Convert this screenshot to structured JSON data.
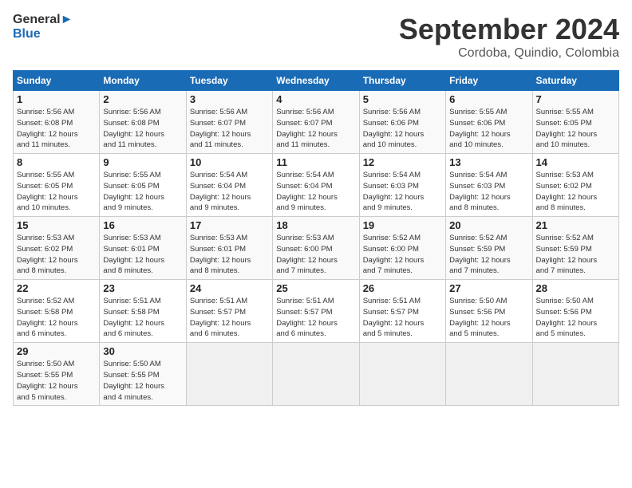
{
  "logo": {
    "line1": "General",
    "line2": "Blue"
  },
  "title": "September 2024",
  "subtitle": "Cordoba, Quindio, Colombia",
  "days_header": [
    "Sunday",
    "Monday",
    "Tuesday",
    "Wednesday",
    "Thursday",
    "Friday",
    "Saturday"
  ],
  "weeks": [
    [
      {
        "day": "1",
        "info": "Sunrise: 5:56 AM\nSunset: 6:08 PM\nDaylight: 12 hours\nand 11 minutes."
      },
      {
        "day": "2",
        "info": "Sunrise: 5:56 AM\nSunset: 6:08 PM\nDaylight: 12 hours\nand 11 minutes."
      },
      {
        "day": "3",
        "info": "Sunrise: 5:56 AM\nSunset: 6:07 PM\nDaylight: 12 hours\nand 11 minutes."
      },
      {
        "day": "4",
        "info": "Sunrise: 5:56 AM\nSunset: 6:07 PM\nDaylight: 12 hours\nand 11 minutes."
      },
      {
        "day": "5",
        "info": "Sunrise: 5:56 AM\nSunset: 6:06 PM\nDaylight: 12 hours\nand 10 minutes."
      },
      {
        "day": "6",
        "info": "Sunrise: 5:55 AM\nSunset: 6:06 PM\nDaylight: 12 hours\nand 10 minutes."
      },
      {
        "day": "7",
        "info": "Sunrise: 5:55 AM\nSunset: 6:05 PM\nDaylight: 12 hours\nand 10 minutes."
      }
    ],
    [
      {
        "day": "8",
        "info": "Sunrise: 5:55 AM\nSunset: 6:05 PM\nDaylight: 12 hours\nand 10 minutes."
      },
      {
        "day": "9",
        "info": "Sunrise: 5:55 AM\nSunset: 6:05 PM\nDaylight: 12 hours\nand 9 minutes."
      },
      {
        "day": "10",
        "info": "Sunrise: 5:54 AM\nSunset: 6:04 PM\nDaylight: 12 hours\nand 9 minutes."
      },
      {
        "day": "11",
        "info": "Sunrise: 5:54 AM\nSunset: 6:04 PM\nDaylight: 12 hours\nand 9 minutes."
      },
      {
        "day": "12",
        "info": "Sunrise: 5:54 AM\nSunset: 6:03 PM\nDaylight: 12 hours\nand 9 minutes."
      },
      {
        "day": "13",
        "info": "Sunrise: 5:54 AM\nSunset: 6:03 PM\nDaylight: 12 hours\nand 8 minutes."
      },
      {
        "day": "14",
        "info": "Sunrise: 5:53 AM\nSunset: 6:02 PM\nDaylight: 12 hours\nand 8 minutes."
      }
    ],
    [
      {
        "day": "15",
        "info": "Sunrise: 5:53 AM\nSunset: 6:02 PM\nDaylight: 12 hours\nand 8 minutes."
      },
      {
        "day": "16",
        "info": "Sunrise: 5:53 AM\nSunset: 6:01 PM\nDaylight: 12 hours\nand 8 minutes."
      },
      {
        "day": "17",
        "info": "Sunrise: 5:53 AM\nSunset: 6:01 PM\nDaylight: 12 hours\nand 8 minutes."
      },
      {
        "day": "18",
        "info": "Sunrise: 5:53 AM\nSunset: 6:00 PM\nDaylight: 12 hours\nand 7 minutes."
      },
      {
        "day": "19",
        "info": "Sunrise: 5:52 AM\nSunset: 6:00 PM\nDaylight: 12 hours\nand 7 minutes."
      },
      {
        "day": "20",
        "info": "Sunrise: 5:52 AM\nSunset: 5:59 PM\nDaylight: 12 hours\nand 7 minutes."
      },
      {
        "day": "21",
        "info": "Sunrise: 5:52 AM\nSunset: 5:59 PM\nDaylight: 12 hours\nand 7 minutes."
      }
    ],
    [
      {
        "day": "22",
        "info": "Sunrise: 5:52 AM\nSunset: 5:58 PM\nDaylight: 12 hours\nand 6 minutes."
      },
      {
        "day": "23",
        "info": "Sunrise: 5:51 AM\nSunset: 5:58 PM\nDaylight: 12 hours\nand 6 minutes."
      },
      {
        "day": "24",
        "info": "Sunrise: 5:51 AM\nSunset: 5:57 PM\nDaylight: 12 hours\nand 6 minutes."
      },
      {
        "day": "25",
        "info": "Sunrise: 5:51 AM\nSunset: 5:57 PM\nDaylight: 12 hours\nand 6 minutes."
      },
      {
        "day": "26",
        "info": "Sunrise: 5:51 AM\nSunset: 5:57 PM\nDaylight: 12 hours\nand 5 minutes."
      },
      {
        "day": "27",
        "info": "Sunrise: 5:50 AM\nSunset: 5:56 PM\nDaylight: 12 hours\nand 5 minutes."
      },
      {
        "day": "28",
        "info": "Sunrise: 5:50 AM\nSunset: 5:56 PM\nDaylight: 12 hours\nand 5 minutes."
      }
    ],
    [
      {
        "day": "29",
        "info": "Sunrise: 5:50 AM\nSunset: 5:55 PM\nDaylight: 12 hours\nand 5 minutes."
      },
      {
        "day": "30",
        "info": "Sunrise: 5:50 AM\nSunset: 5:55 PM\nDaylight: 12 hours\nand 4 minutes."
      },
      {
        "day": "",
        "info": ""
      },
      {
        "day": "",
        "info": ""
      },
      {
        "day": "",
        "info": ""
      },
      {
        "day": "",
        "info": ""
      },
      {
        "day": "",
        "info": ""
      }
    ]
  ]
}
